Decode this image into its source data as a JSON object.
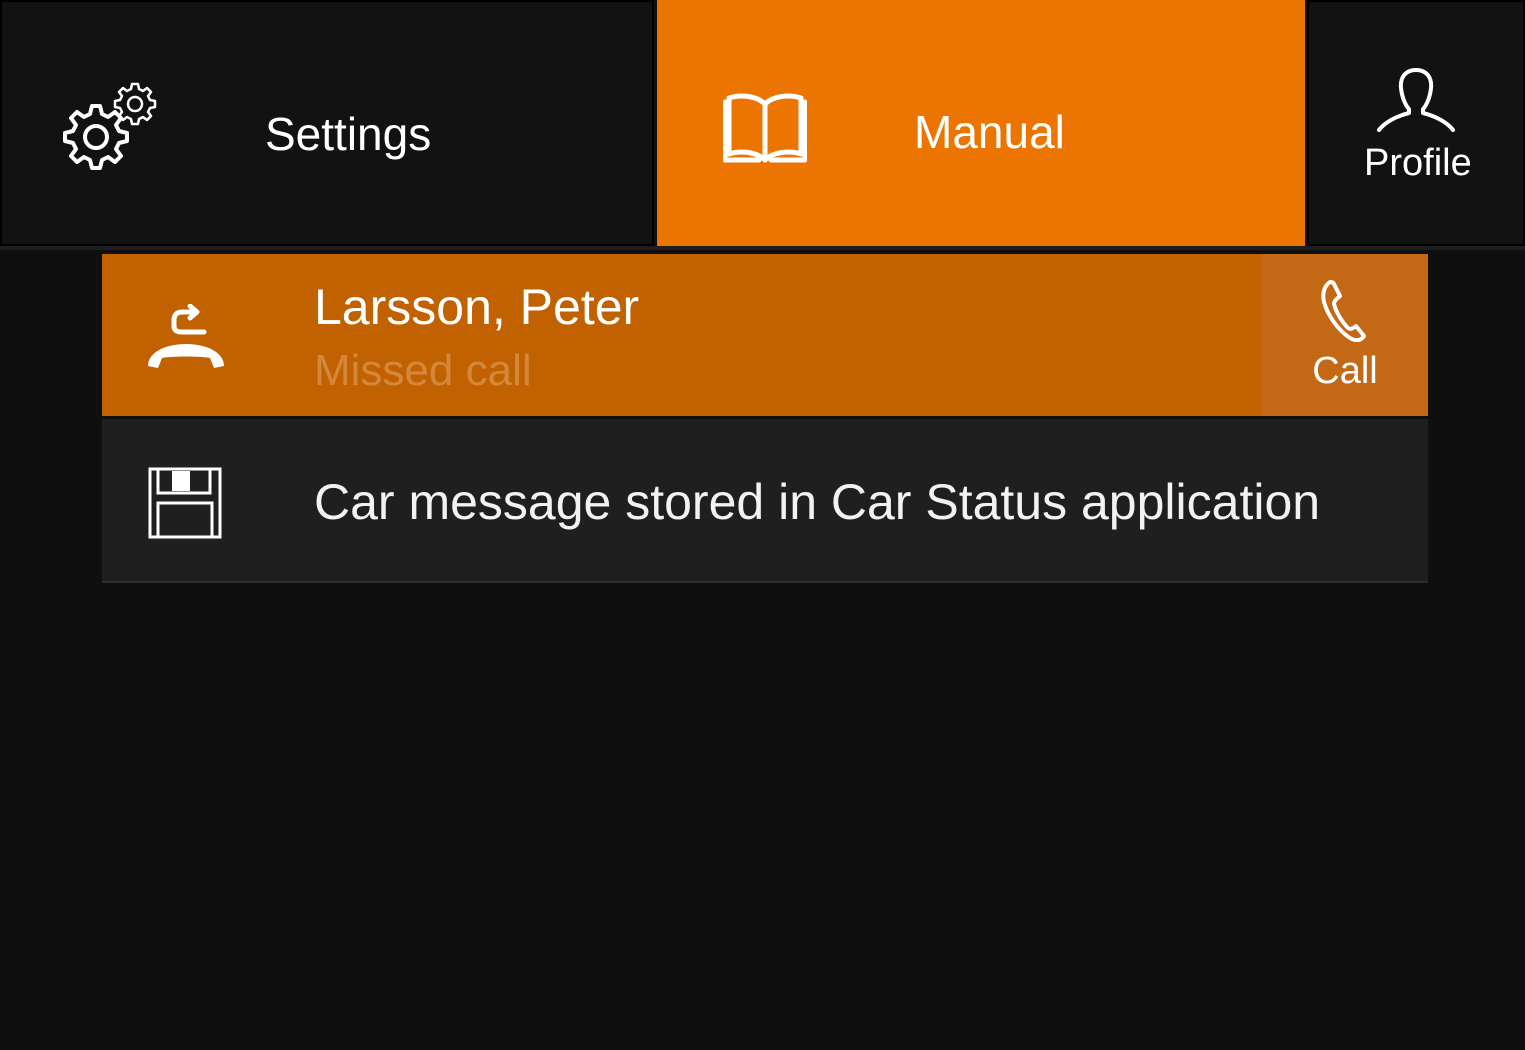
{
  "topbar": {
    "settings": {
      "label": "Settings",
      "icon": "gear-icon"
    },
    "manual": {
      "label": "Manual",
      "icon": "book-icon",
      "active": true
    },
    "profile": {
      "label": "Profile",
      "icon": "person-icon"
    }
  },
  "notifications": [
    {
      "icon": "missed-call-icon",
      "title": "Larsson, Peter",
      "subtitle": "Missed call",
      "action": {
        "label": "Call",
        "icon": "phone-icon"
      }
    },
    {
      "icon": "floppy-disk-icon",
      "text": "Car message stored in Car Status application"
    }
  ],
  "colors": {
    "accent": "#ec7400",
    "highlight_row": "#c26100",
    "call_button": "#c36814",
    "background": "#0f0f0f",
    "row_background": "#1f1f1f",
    "subtitle": "#d3883c"
  }
}
